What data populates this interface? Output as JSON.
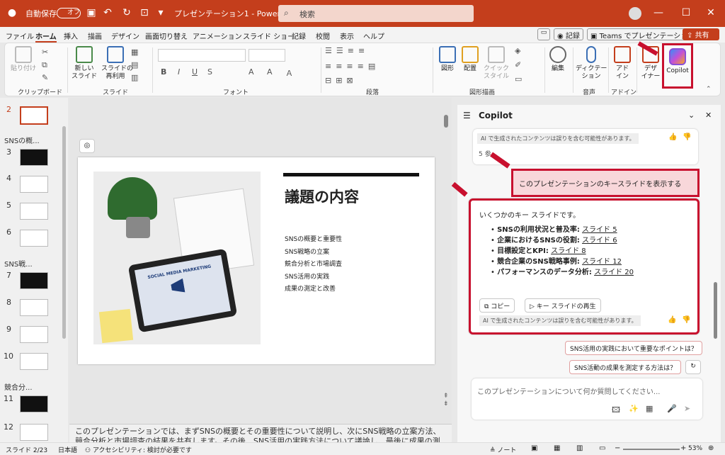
{
  "title_bar": {
    "autosave_label": "自動保存",
    "autosave_state": "オフ",
    "doc_title": "プレゼンテーション1 - Power...",
    "search_placeholder": "検索"
  },
  "menu": {
    "items": [
      "ファイル",
      "ホーム",
      "挿入",
      "描画",
      "デザイン",
      "画面切り替え",
      "アニメーション",
      "スライド ショー",
      "記録",
      "校閲",
      "表示",
      "ヘルプ"
    ],
    "record": "記録",
    "teams": "Teams でプレゼンテーション",
    "share": "共有"
  },
  "ribbon": {
    "paste": "貼り付け",
    "clipboard": "クリップボード",
    "new_slide": "新しい\nスライド",
    "reuse": "スライドの\n再利用",
    "slides": "スライド",
    "font": "フォント",
    "paragraph": "段落",
    "shape": "図形",
    "arrange": "配置",
    "quick_style": "クイック\nスタイル",
    "drawing": "図形描画",
    "edit": "編集",
    "dictate": "ディクテー\nション",
    "voice": "音声",
    "addin": "アド\nイン",
    "addins": "アドイン",
    "designer": "デザ\nイナー",
    "copilot": "Copilot"
  },
  "thumbnails": {
    "section1": "SNSの概...",
    "section2": "SNS戦...",
    "section3": "競合分...",
    "numbers": [
      "2",
      "3",
      "4",
      "5",
      "6",
      "7",
      "8",
      "9",
      "10",
      "11",
      "12"
    ]
  },
  "slide": {
    "title": "議題の内容",
    "items": [
      "SNSの概要と重要性",
      "SNS戦略の立案",
      "競合分析と市場調査",
      "SNS活用の実践",
      "成果の測定と改善"
    ],
    "tablet_text": "SOCIAL MEDIA MARKETING"
  },
  "notes": "このプレゼンテーションでは、まずSNSの概要とその重要性について説明し、次にSNS戦略の立案方法、競合分析と市場調査の結果を共有します。その後、SNS活用の実践方法について議論し、最後に成果の測定と改善",
  "copilot": {
    "header": "Copilot",
    "disclaimer": "AI で生成されたコンテンツは誤りを含む可能性があります。",
    "refs": "5 参...",
    "user_msg": "このプレゼンテーションのキースライドを表示する",
    "intro": "いくつかのキー スライドです。",
    "bullets": [
      {
        "bold": "SNSの利用状況と普及率:",
        "link": "スライド 5"
      },
      {
        "bold": "企業におけるSNSの役割:",
        "link": "スライド 6"
      },
      {
        "bold": "目標設定とKPI:",
        "link": "スライド 8"
      },
      {
        "bold": "競合企業のSNS戦略事例:",
        "link": "スライド 12"
      },
      {
        "bold": "パフォーマンスのデータ分析:",
        "link": "スライド 20"
      }
    ],
    "copy": "コピー",
    "play": "キー スライドの再生",
    "sug1": "SNS活用の実践において重要なポイントは？",
    "sug2": "SNS活動の成果を測定する方法は？",
    "input_placeholder": "このプレゼンテーションについて何か質問してください..."
  },
  "status": {
    "slide": "スライド 2/23",
    "lang": "日本語",
    "access": "アクセシビリティ: 検討が必要です",
    "notes": "ノート",
    "zoom": "53%"
  },
  "colors": {
    "brand": "#c43e1c",
    "highlight": "#c8102e"
  }
}
